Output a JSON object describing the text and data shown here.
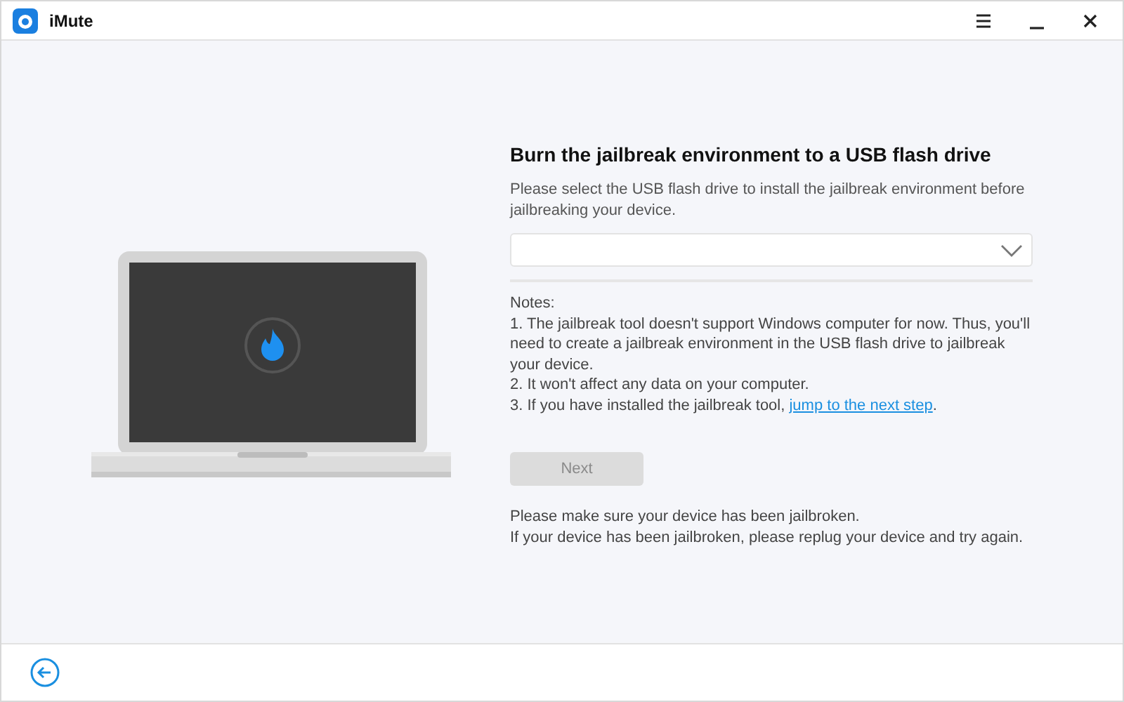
{
  "window": {
    "title": "iMute"
  },
  "panel": {
    "heading": "Burn the jailbreak environment to a USB flash drive",
    "description": "Please select the USB flash drive to install the jailbreak environment before jailbreaking your device.",
    "notes": {
      "heading": "Notes:",
      "items": [
        {
          "text": "1. The jailbreak tool doesn't support Windows computer for now. Thus, you'll need to create a jailbreak environment in the USB flash drive to jailbreak your device."
        },
        {
          "text": "2. It won't affect any data on your computer."
        },
        {
          "text": "3. If you have installed the jailbreak tool, ",
          "link": "jump to the next step",
          "after": "."
        }
      ]
    },
    "next_button": {
      "label": "Next",
      "disabled": true
    },
    "messages": [
      "Please make sure your device has been jailbroken.",
      "If your device has been jailbroken, please replug your device and try again."
    ]
  }
}
